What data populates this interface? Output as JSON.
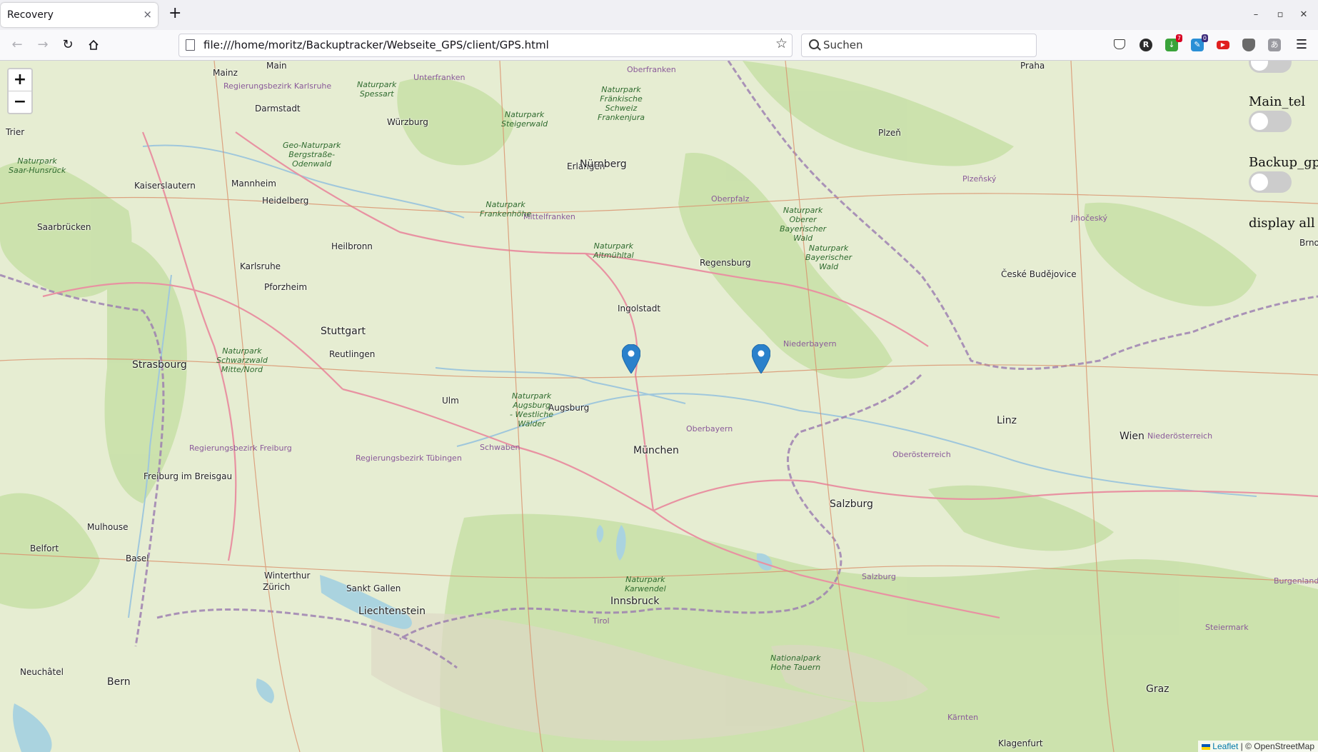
{
  "browser": {
    "tab_title": "Recovery",
    "tab_close_icon": "×",
    "new_tab_icon": "+",
    "url": "file:///home/moritz/Backuptracker/Webseite_GPS/client/GPS.html",
    "search_placeholder": "Suchen",
    "window_buttons": {
      "minimize": "–",
      "maximize": "▫",
      "close": "✕"
    },
    "extensions": [
      {
        "name": "pocket-icon",
        "badge": ""
      },
      {
        "name": "r-extension-icon",
        "badge": ""
      },
      {
        "name": "download-extension-icon",
        "badge": "7"
      },
      {
        "name": "clipboard-extension-icon",
        "badge": "0"
      },
      {
        "name": "youtube-extension-icon",
        "badge": ""
      },
      {
        "name": "shield-extension-icon",
        "badge": ""
      },
      {
        "name": "translate-extension-icon",
        "badge": ""
      }
    ]
  },
  "map": {
    "zoom_in": "+",
    "zoom_out": "−",
    "toggles": [
      {
        "label": "Main_tel",
        "on": false
      },
      {
        "label": "Backup_gps",
        "on": false
      },
      {
        "label": "display all",
        "on": false
      }
    ],
    "attribution": {
      "leaflet": "Leaflet",
      "separator": "|",
      "osm": "© OpenStreetMap"
    },
    "marker_count": 2,
    "places": {
      "big": [
        "Nürnberg",
        "Stuttgart",
        "Strasbourg",
        "München",
        "Linz",
        "Wien",
        "Salzburg",
        "Liechtenstein",
        "Bern",
        "Graz",
        "Innsbruck"
      ],
      "city": [
        "Mainz",
        "Main",
        "Darmstadt",
        "Würzburg",
        "Erlangen",
        "Praha",
        "Plzeň",
        "Trier",
        "Mannheim",
        "Heidelberg",
        "Kaiserslautern",
        "Saarbrücken",
        "Heilbronn",
        "Karlsruhe",
        "Pforzheim",
        "Regensburg",
        "Ingolstadt",
        "Reutlingen",
        "Ulm",
        "Augsburg",
        "České Budějovice",
        "Freiburg im Breisgau",
        "Mulhouse",
        "Belfort",
        "Basel",
        "Winterthur",
        "Sankt Gallen",
        "Zürich",
        "Neuchâtel",
        "Brno",
        "Klagenfurt"
      ],
      "park": [
        "Naturpark\nFränkische\nSchweiz\nFrankenjura",
        "Naturpark\nAltmühltal",
        "Naturpark\nBayerischer\nWald",
        "Naturpark\nSchwarzwald\nMitte/Nord",
        "Naturpark\nSaar-Hunsrück",
        "Geo-Naturpark\nBergstraße-\nOdenwald",
        "Naturpark\nKarwendel",
        "Nationalpark\nHohe Tauern",
        "Naturpark\nSteigerwald",
        "Naturpark\nFrankenhöhe",
        "Naturpark\nAugsburg\n- Westliche\nWälder",
        "Naturpark\nSpessart",
        "Naturpark\nOberer\nBayerischer\nWald"
      ],
      "region": [
        "Oberbayern",
        "Niederbayern",
        "Oberösterreich",
        "Niederösterreich",
        "Oberpfalz",
        "Mittelfranken",
        "Schwaben",
        "Unterfranken",
        "Oberfranken",
        "Tirol",
        "Salzburg",
        "Steiermark",
        "Kärnten",
        "Burgenland",
        "Jihočeský",
        "Plzeňský",
        "Regierungsbezirk Freiburg",
        "Regierungsbezirk Tübingen",
        "Regierungsbezirk Karlsruhe"
      ]
    }
  }
}
